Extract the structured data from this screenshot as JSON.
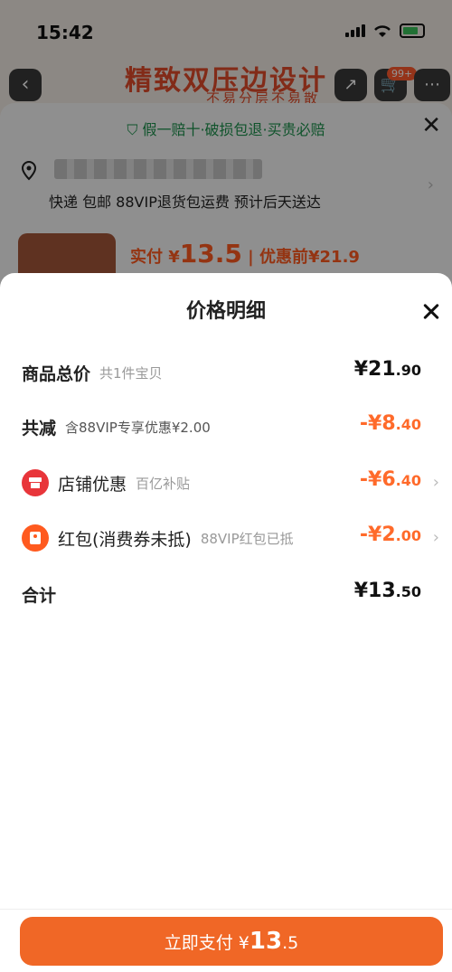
{
  "status": {
    "time": "15:42"
  },
  "background": {
    "banner_title": "精致双压边设计",
    "banner_sub": "不易分层不易散",
    "cart_badge": "99+",
    "guarantee": "假一赔十·破损包退·买贵必赔",
    "delivery": "快递 包邮 88VIP退货包运费 预计后天送达",
    "price_label": "实付 ¥",
    "price_big": "13.5",
    "price_before": "| 优惠前¥21.9"
  },
  "modal": {
    "title": "价格明细",
    "rows": [
      {
        "label": "商品总价",
        "note": "共1件宝贝",
        "amount_int": "¥21",
        "amount_dec": ".90"
      },
      {
        "label": "共减",
        "note": "含88VIP专享优惠¥2.00",
        "amount_int": "-¥8",
        "amount_dec": ".40"
      },
      {
        "label": "店铺优惠",
        "note": "百亿补贴",
        "amount_int": "-¥6",
        "amount_dec": ".40",
        "icon": "store-icon"
      },
      {
        "label": "红包(消费券未抵)",
        "note": "88VIP红包已抵",
        "amount_int": "-¥2",
        "amount_dec": ".00",
        "icon": "red-packet-icon"
      },
      {
        "label": "合计",
        "note": "",
        "amount_int": "¥13",
        "amount_dec": ".50"
      }
    ]
  },
  "pay": {
    "label": "立即支付 ¥",
    "amount_int": "13",
    "amount_dec": ".5"
  },
  "colors": {
    "accent": "#f06726",
    "discount": "#ff6a2a",
    "store_icon": "#e8353a"
  }
}
